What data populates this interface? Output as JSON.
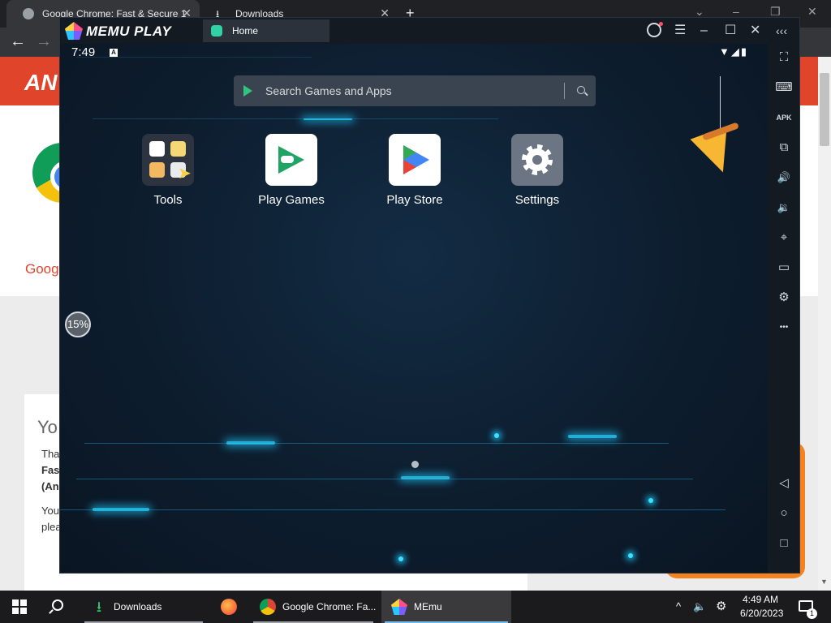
{
  "chrome": {
    "tabs": [
      {
        "label": "Google Chrome: Fast & Secure 1",
        "close": "✕"
      },
      {
        "label": "Downloads",
        "close": "✕"
      }
    ],
    "new_tab": "+",
    "window_controls": [
      "⌄",
      "–",
      "❐",
      "✕"
    ],
    "nav": {
      "back": "←",
      "forward": "→"
    },
    "page": {
      "logo_text": "AN",
      "google_link": "Goog",
      "heading_partial": "Yo",
      "lines": [
        {
          "text": "Tha",
          "bold": false
        },
        {
          "text": "Fas",
          "bold": true
        },
        {
          "text": "(An",
          "bold": true
        },
        {
          "text": "You",
          "bold": false
        },
        {
          "text": "plea",
          "bold": false
        }
      ]
    }
  },
  "memu": {
    "brand": "MEMU PLAY",
    "tab_label": "Home",
    "title_buttons": [
      {
        "name": "menu-icon",
        "glyph": "☰"
      },
      {
        "name": "minimize-icon",
        "glyph": "–"
      },
      {
        "name": "maximize-icon",
        "glyph": "☐"
      },
      {
        "name": "close-icon",
        "glyph": "✕"
      },
      {
        "name": "collapse-sidebar-icon",
        "glyph": "‹‹‹"
      }
    ],
    "status": {
      "time": "7:49",
      "notif_letter": "A",
      "icons": "▼◢▮"
    },
    "search": {
      "placeholder": "Search Games and Apps"
    },
    "apps": [
      {
        "name": "Tools"
      },
      {
        "name": "Play Games"
      },
      {
        "name": "Play Store"
      },
      {
        "name": "Settings"
      }
    ],
    "progress": "15%",
    "sidebar": [
      {
        "name": "fullscreen-icon",
        "glyph": "⛶"
      },
      {
        "name": "keyboard-icon",
        "glyph": "⌨"
      },
      {
        "name": "apk-icon",
        "glyph": "APK"
      },
      {
        "name": "multi-instance-icon",
        "glyph": "⧉"
      },
      {
        "name": "volume-up-icon",
        "glyph": "🔊"
      },
      {
        "name": "volume-down-icon",
        "glyph": "🔉"
      },
      {
        "name": "location-icon",
        "glyph": "⌖"
      },
      {
        "name": "folder-icon",
        "glyph": "▭"
      },
      {
        "name": "settings-icon",
        "glyph": "⚙"
      },
      {
        "name": "more-icon",
        "glyph": "•••"
      },
      {
        "name": "back-icon",
        "glyph": "◁"
      },
      {
        "name": "home-icon",
        "glyph": "○"
      },
      {
        "name": "recents-icon",
        "glyph": "□"
      }
    ]
  },
  "taskbar": {
    "items": [
      {
        "label": "Downloads",
        "color": "#2ecc71"
      },
      {
        "label": "",
        "color": "#ff7139"
      },
      {
        "label": "Google Chrome: Fa...",
        "color": "#4285f4"
      },
      {
        "label": "MEmu",
        "color": "#7b5cff"
      }
    ],
    "tray": {
      "chevron": "^",
      "volume": "🔈",
      "settings": "⚙"
    },
    "time": "4:49 AM",
    "date": "6/20/2023",
    "notification_count": "1"
  }
}
